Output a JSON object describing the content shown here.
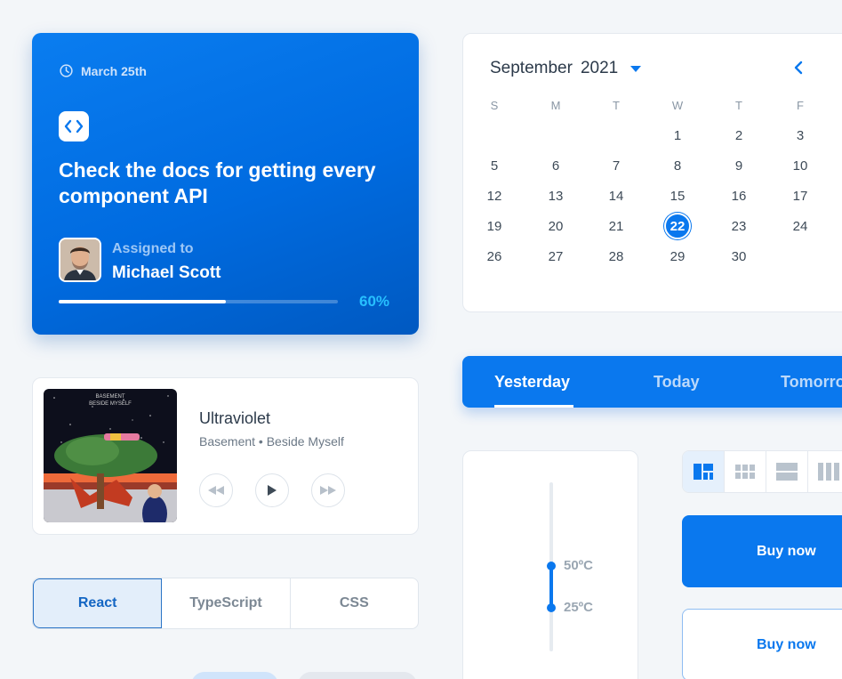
{
  "task": {
    "date": "March 25th",
    "title": "Check the docs for getting every component API",
    "assigned_label": "Assigned to",
    "assignee": "Michael Scott",
    "progress_label": "60%",
    "progress": 0.6,
    "icons": [
      "clock-icon",
      "code-icon"
    ]
  },
  "calendar": {
    "month": "September",
    "year": "2021",
    "weekdays": [
      "S",
      "M",
      "T",
      "W",
      "T",
      "F"
    ],
    "weeks": [
      [
        "",
        "",
        "",
        "1",
        "2",
        "3"
      ],
      [
        "5",
        "6",
        "7",
        "8",
        "9",
        "10"
      ],
      [
        "12",
        "13",
        "14",
        "15",
        "16",
        "17"
      ],
      [
        "19",
        "20",
        "21",
        "22",
        "23",
        "24"
      ],
      [
        "26",
        "27",
        "28",
        "29",
        "30",
        ""
      ]
    ],
    "selected": "22",
    "accent": "#0a78ee"
  },
  "music": {
    "title": "Ultraviolet",
    "meta": "Basement • Beside Myself",
    "album_art_text": "BASEMENT BESIDE MYSELF",
    "controls": [
      "rewind-icon",
      "play-icon",
      "fast-forward-icon"
    ]
  },
  "segmented": {
    "items": [
      "React",
      "TypeScript",
      "CSS"
    ],
    "active": "React"
  },
  "day_tabs": {
    "items": [
      "Yesterday",
      "Today",
      "Tomorrow"
    ],
    "active": "Yesterday"
  },
  "slider": {
    "high_label": "50ºC",
    "low_label": "25ºC",
    "high": 50,
    "low": 25
  },
  "layout_switch": {
    "icons": [
      "dashboard-layout-icon",
      "grid-layout-icon",
      "rows-layout-icon",
      "columns-layout-icon"
    ],
    "active": "dashboard-layout-icon"
  },
  "buttons": {
    "buy_solid": "Buy now",
    "buy_outline": "Buy now"
  },
  "colors": {
    "primary": "#0a78ee",
    "progress_text": "#27c0ff",
    "background": "#f3f6f9"
  }
}
